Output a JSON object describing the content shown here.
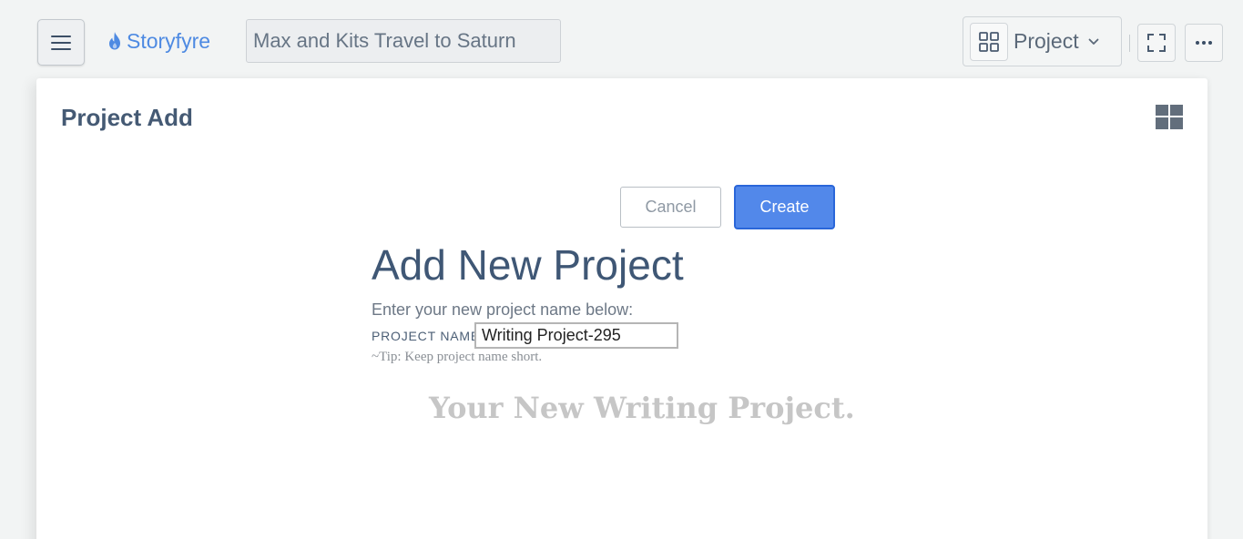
{
  "header": {
    "brand": "Storyfyre",
    "project_title": "Max and Kits Travel to Saturn",
    "project_switch_label": "Project"
  },
  "icons": {
    "menu": "hamburger-icon",
    "brand": "flame-icon",
    "switch": "grid-icon",
    "chevron": "chevron-down-icon",
    "fullscreen": "expand-icon",
    "more": "ellipsis-icon",
    "layout": "layout-grid-icon"
  },
  "panel": {
    "title": "Project Add",
    "cancel_label": "Cancel",
    "create_label": "Create",
    "heading": "Add New Project",
    "instructions": "Enter your new project name below:",
    "field_label": "PROJECT NAME",
    "field_value": "Writing Project-295",
    "tip": "~Tip: Keep project name short.",
    "tagline": "Your New Writing Project."
  },
  "colors": {
    "accent": "#4e8ae2",
    "primary_button": "#5288ea",
    "heading": "#3f5775",
    "background": "#f2f4f4"
  }
}
